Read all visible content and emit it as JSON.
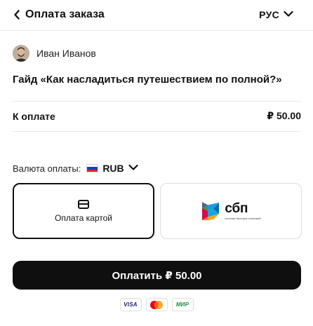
{
  "header": {
    "back_label": "Оплата заказа",
    "language": "РУС"
  },
  "author": {
    "name": "Иван Иванов"
  },
  "product": {
    "title": "Гайд «Как насладиться путешествием по полной?»"
  },
  "total": {
    "label": "К оплате",
    "amount": "₽ 50.00"
  },
  "currency": {
    "label": "Валюта оплаты:",
    "code": "RUB"
  },
  "payment_methods": {
    "card_label": "Оплата картой",
    "sbp_logo_word": "сбп",
    "sbp_logo_sub": "система быстрых платежей",
    "selected": "card"
  },
  "pay_button": {
    "label": "Оплатить ₽ 50.00"
  },
  "accepted_cards": {
    "visa": "VISA",
    "mastercard": "mastercard",
    "mir": "МИР"
  },
  "colors": {
    "accent": "#0f0f0f",
    "border_selected": "#111111",
    "border_default": "#dcdcdc"
  }
}
